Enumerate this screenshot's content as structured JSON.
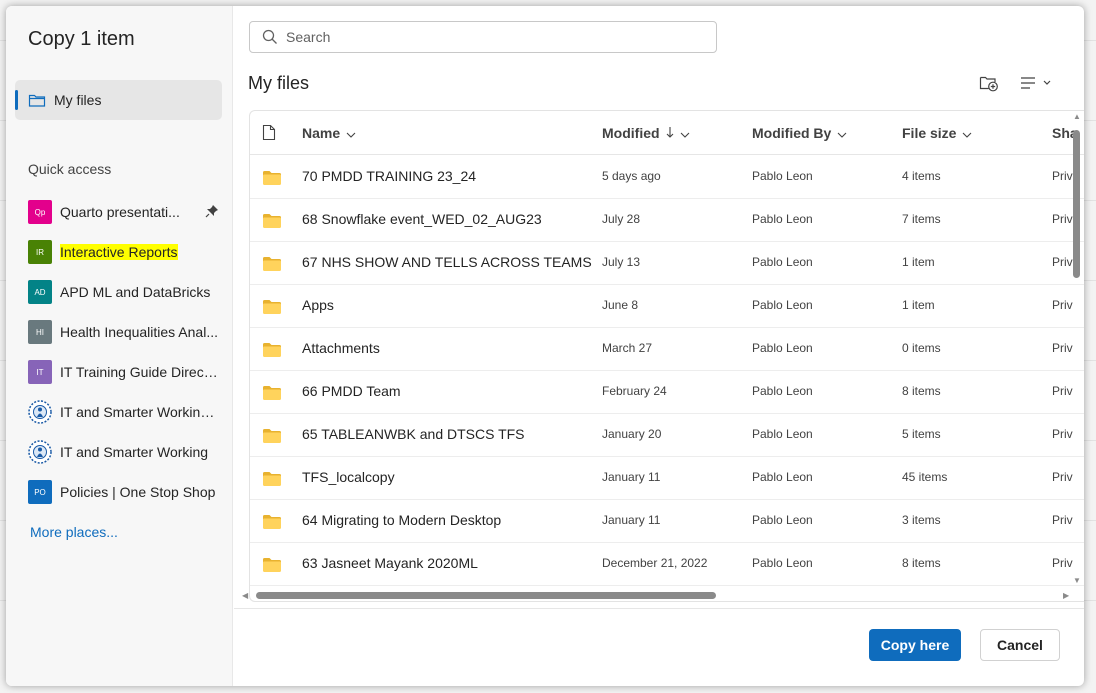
{
  "dialog": {
    "title": "Copy 1 item"
  },
  "nav": {
    "my_files_label": "My files",
    "quick_access_heading": "Quick access",
    "more_places_label": "More places...",
    "quick_access_items": [
      {
        "badge": "Qp",
        "badge_color": "#e3008c",
        "label": "Quarto presentati...",
        "pinned": true
      },
      {
        "badge": "IR",
        "badge_color": "#498205",
        "label": "Interactive Reports",
        "highlighted": true
      },
      {
        "badge": "AD",
        "badge_color": "#038387",
        "label": "APD ML and DataBricks"
      },
      {
        "badge": "HI",
        "badge_color": "#69797e",
        "label": "Health Inequalities Anal..."
      },
      {
        "badge": "IT",
        "badge_color": "#8764b8",
        "label": "IT Training Guide Direct..."
      },
      {
        "badge": "",
        "badge_icon": "nhs-logo-icon",
        "label": "IT and Smarter Working..."
      },
      {
        "badge": "",
        "badge_icon": "nhs-logo-icon",
        "label": "IT and Smarter Working"
      },
      {
        "badge": "PO",
        "badge_color": "#0f6cbd",
        "label": "Policies | One Stop Shop"
      }
    ]
  },
  "search": {
    "placeholder": "Search"
  },
  "main": {
    "title": "My files",
    "columns": {
      "name": "Name",
      "modified": "Modified",
      "modified_by": "Modified By",
      "file_size": "File size",
      "sharing": "Sha"
    },
    "rows": [
      {
        "name": "70 PMDD TRAINING 23_24",
        "modified": "5 days ago",
        "modified_by": "Pablo Leon",
        "size": "4 items",
        "sharing": "Priv"
      },
      {
        "name": "68 Snowflake event_WED_02_AUG23",
        "modified": "July 28",
        "modified_by": "Pablo Leon",
        "size": "7 items",
        "sharing": "Priv"
      },
      {
        "name": "67 NHS SHOW AND TELLS ACROSS TEAMS",
        "modified": "July 13",
        "modified_by": "Pablo Leon",
        "size": "1 item",
        "sharing": "Priv"
      },
      {
        "name": "Apps",
        "modified": "June 8",
        "modified_by": "Pablo Leon",
        "size": "1 item",
        "sharing": "Priv"
      },
      {
        "name": "Attachments",
        "modified": "March 27",
        "modified_by": "Pablo Leon",
        "size": "0 items",
        "sharing": "Priv"
      },
      {
        "name": "66 PMDD Team",
        "modified": "February 24",
        "modified_by": "Pablo Leon",
        "size": "8 items",
        "sharing": "Priv"
      },
      {
        "name": "65 TABLEANWBK and DTSCS TFS",
        "modified": "January 20",
        "modified_by": "Pablo Leon",
        "size": "5 items",
        "sharing": "Priv"
      },
      {
        "name": "TFS_localcopy",
        "modified": "January 11",
        "modified_by": "Pablo Leon",
        "size": "45 items",
        "sharing": "Priv"
      },
      {
        "name": "64 Migrating to Modern Desktop",
        "modified": "January 11",
        "modified_by": "Pablo Leon",
        "size": "3 items",
        "sharing": "Priv"
      },
      {
        "name": "63 Jasneet Mayank 2020ML",
        "modified": "December 21, 2022",
        "modified_by": "Pablo Leon",
        "size": "8 items",
        "sharing": "Priv"
      }
    ]
  },
  "footer": {
    "primary_label": "Copy here",
    "cancel_label": "Cancel"
  },
  "colors": {
    "accent": "#0f6cbd",
    "folder": "#ffd35c",
    "highlight": "#ffff00"
  }
}
